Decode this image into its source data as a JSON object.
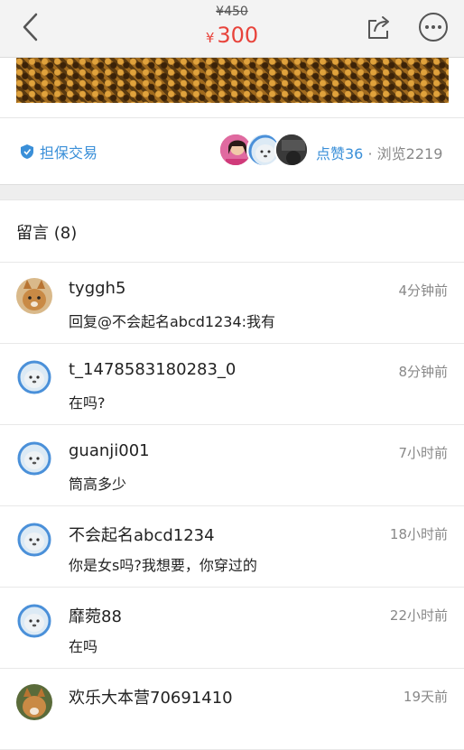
{
  "header": {
    "original_price": "¥450",
    "currency": "¥",
    "price": "300",
    "icons": {
      "back": "chevron-left-icon",
      "share": "share-icon",
      "more": "more-icon"
    }
  },
  "product": {
    "image": "product-photo"
  },
  "info": {
    "guarantee_label": "担保交易",
    "likes": "点赞36",
    "separator": "·",
    "views": "浏览2219"
  },
  "comments": {
    "title": "留言 (8)",
    "items": [
      {
        "name": "tyggh5",
        "time": "4分钟前",
        "text": "回复@不会起名abcd1234:我有",
        "avatar": "dog"
      },
      {
        "name": "t_1478583180283_0",
        "time": "8分钟前",
        "text": "在吗?",
        "avatar": "seal"
      },
      {
        "name": "guanji001",
        "time": "7小时前",
        "text": "筒高多少",
        "avatar": "seal"
      },
      {
        "name": "不会起名abcd1234",
        "time": "18小时前",
        "text": "你是女s吗?我想要，你穿过的",
        "avatar": "seal"
      },
      {
        "name": "靡菀88",
        "time": "22小时前",
        "text": "在吗",
        "avatar": "seal"
      },
      {
        "name": "欢乐大本营70691410",
        "time": "19天前",
        "text": "",
        "avatar": "dog"
      }
    ]
  },
  "colors": {
    "accent": "#3a8fd8",
    "price": "#e8433b"
  }
}
